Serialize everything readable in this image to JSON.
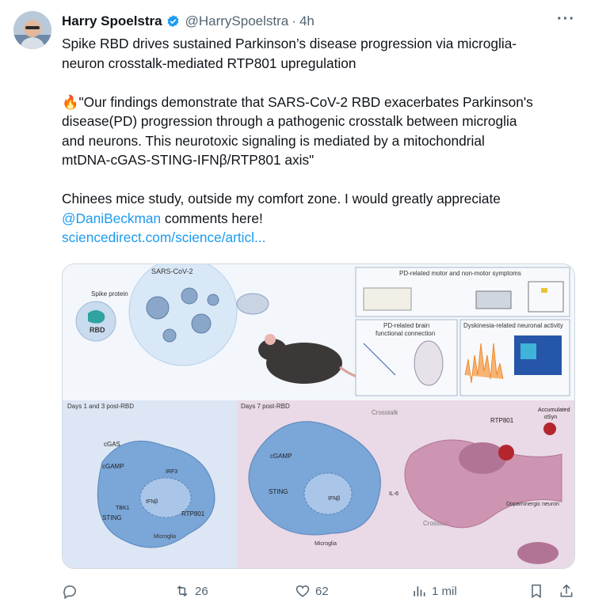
{
  "author": {
    "name": "Harry Spoelstra",
    "handle": "@HarrySpoelstra",
    "separator": "·",
    "time": "4h",
    "avatar_icon": "person-photo"
  },
  "tweet": {
    "title_line1": "Spike RBD drives sustained Parkinson’s disease progression via microglia-",
    "title_line2": "neuron crosstalk-mediated RTP801 upregulation",
    "quote_line1": "\"Our findings demonstrate that SARS-CoV-2 RBD exacerbates Parkinson's",
    "quote_line2": "disease(PD) progression through a pathogenic crosstalk between microglia",
    "quote_line3": "and neurons. This neurotoxic signaling is mediated by a mitochondrial",
    "quote_line4": "mtDNA-cGAS-STING-IFNβ/RTP801 axis\"",
    "comment_line1": "Chinees mice study, outside my comfort zone. I would greatly appreciate",
    "mention": "@DaniBeckman",
    "comment_line2_rest": "  comments here!",
    "link": "sciencedirect.com/science/articl..."
  },
  "figure": {
    "sars": "SARS-CoV-2",
    "spike": "Spike protein",
    "rbd": "RBD",
    "pd_symptoms": "PD-related motor and non-motor symptoms",
    "pd_brain": "PD-related brain",
    "functional": "functional connection",
    "dyskinesia": "Dyskinesia-related neuronal activity",
    "days13": "Days 1 and 3 post-RBD",
    "days7": "Days 7 post-RBD",
    "cgas": "cGAS",
    "cgamp": "cGAMP",
    "irf3": "IRF3",
    "tbk1": "TBK1",
    "sting": "STING",
    "ifnb": "IFNβ",
    "rtp801": "RTP801",
    "microglia": "Microglia",
    "il6": "IL-6",
    "crosstalk": "Crosstalk",
    "dopaminergic": "Dopaminergic neuron",
    "accumulated": "Accumulated",
    "asyn": "αSyn"
  },
  "actions": {
    "reply_count": "",
    "retweet_count": "26",
    "like_count": "62",
    "views_count": "1 mil"
  },
  "colors": {
    "accent": "#1d9bf0",
    "muted": "#536471",
    "verified": "#1d9bf0",
    "microglia": "#7aa6d8",
    "neuron": "#c98aa8"
  }
}
